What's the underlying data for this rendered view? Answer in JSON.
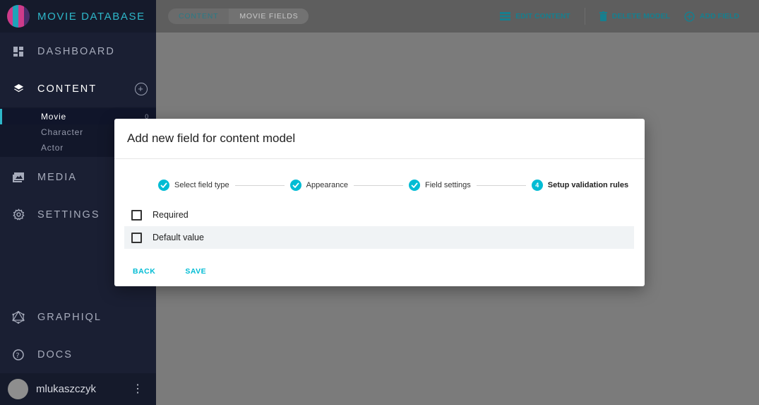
{
  "brand": {
    "title": "MOVIE DATABASE"
  },
  "sidebar": {
    "items": [
      {
        "label": "DASHBOARD",
        "icon": "dashboard-icon"
      },
      {
        "label": "CONTENT",
        "icon": "layers-icon"
      },
      {
        "label": "MEDIA",
        "icon": "image-icon"
      },
      {
        "label": "SETTINGS",
        "icon": "gear-icon"
      }
    ],
    "content_models": [
      {
        "label": "Movie",
        "count": "0"
      },
      {
        "label": "Character"
      },
      {
        "label": "Actor"
      }
    ],
    "bottom_items": [
      {
        "label": "GRAPHIQL",
        "icon": "graphql-icon"
      },
      {
        "label": "DOCS",
        "icon": "help-icon"
      }
    ]
  },
  "user": {
    "name": "mlukaszczyk"
  },
  "breadcrumb": [
    "CONTENT",
    "MOVIE FIELDS"
  ],
  "toolbar": {
    "edit_label": "EDIT CONTENT",
    "delete_label": "DELETE MODEL",
    "add_label": "ADD FIELD"
  },
  "dialog": {
    "title": "Add new field for content model",
    "steps": [
      {
        "label": "Select field type"
      },
      {
        "label": "Appearance"
      },
      {
        "label": "Field settings"
      },
      {
        "label": "Setup validation rules",
        "number": "4"
      }
    ],
    "options": [
      {
        "label": "Required"
      },
      {
        "label": "Default value"
      }
    ],
    "back_label": "BACK",
    "save_label": "SAVE"
  },
  "colors": {
    "accent": "#00bcd4",
    "sidebar": "#1a1f33"
  }
}
